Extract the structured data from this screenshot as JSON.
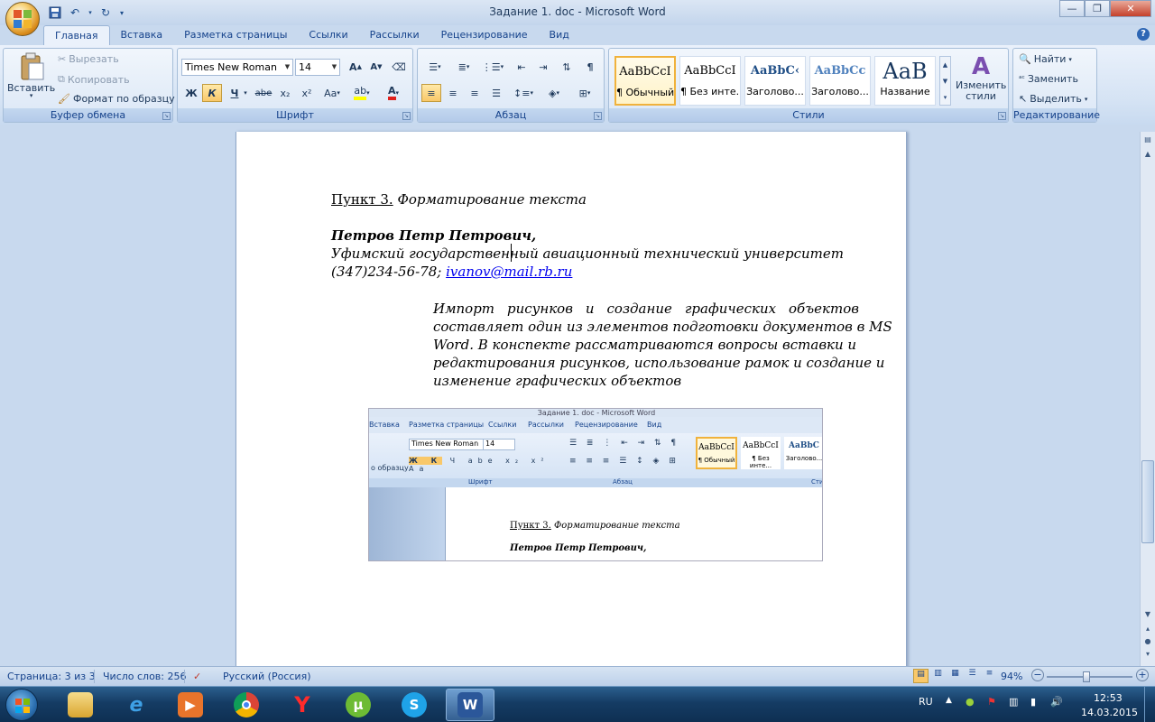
{
  "window": {
    "title": "Задание 1. doc - Microsoft Word"
  },
  "qat": {
    "save_icon": "save-icon",
    "undo_icon": "undo-icon",
    "redo_icon": "redo-icon"
  },
  "tabs": [
    "Главная",
    "Вставка",
    "Разметка страницы",
    "Ссылки",
    "Рассылки",
    "Рецензирование",
    "Вид"
  ],
  "ribbon": {
    "clipboard": {
      "label": "Буфер обмена",
      "paste": "Вставить",
      "cut": "Вырезать",
      "copy": "Копировать",
      "format_painter": "Формат по образцу"
    },
    "font": {
      "label": "Шрифт",
      "font_name": "Times New Roman",
      "font_size": "14",
      "bold": "Ж",
      "italic": "К",
      "underline": "Ч",
      "strike": "abe",
      "subscript": "x₂",
      "superscript": "x²",
      "change_case": "Aa"
    },
    "paragraph": {
      "label": "Абзац"
    },
    "styles": {
      "label": "Стили",
      "items": [
        {
          "sample": "AaBbCcI",
          "name": "¶ Обычный"
        },
        {
          "sample": "AaBbCcI",
          "name": "¶ Без инте..."
        },
        {
          "sample": "AaBbC‹",
          "name": "Заголово..."
        },
        {
          "sample": "AaBbCc",
          "name": "Заголово..."
        },
        {
          "sample": "AaB",
          "name": "Название"
        }
      ],
      "change_styles": "Изменить стили"
    },
    "editing": {
      "label": "Редактирование",
      "find": "Найти",
      "replace": "Заменить",
      "select": "Выделить"
    }
  },
  "document": {
    "heading_label": "Пункт 3.",
    "heading_text": "Форматирование текста",
    "author": "Петров Петр Петрович,",
    "university": "Уфимский государственный авиационный технический университет",
    "phone": "(347)234-56-78; ",
    "email": "ivanov@mail.rb.ru",
    "abstract": [
      "Импорт рисунков и создание графических объектов",
      "составляет один из элементов подготовки документов в MS",
      "Word. В конспекте рассматриваются вопросы вставки и",
      "редактирования рисунков, использование рамок и создание и",
      "изменение графических объектов"
    ],
    "embedded": {
      "title": "Задание 1. doc - Microsoft Word",
      "tabs": [
        "Вставка",
        "Разметка страницы",
        "Ссылки",
        "Рассылки",
        "Рецензирование",
        "Вид"
      ],
      "font_name": "Times New Roman",
      "font_size": "14",
      "left_label": "о образцу",
      "group_font": "Шрифт",
      "group_par": "Абзац",
      "group_styles": "Сти",
      "styles": [
        {
          "sample": "AaBbCcI",
          "name": "¶ Обычный"
        },
        {
          "sample": "AaBbCcI",
          "name": "¶ Без инте..."
        },
        {
          "sample": "AaBbC",
          "name": "Заголово..."
        }
      ],
      "heading_label": "Пункт 3.",
      "heading_text": "Форматирование текста",
      "author": "Петров Петр Петрович,"
    }
  },
  "status": {
    "page": "Страница: 3 из 3",
    "words": "Число слов: 256",
    "language": "Русский (Россия)",
    "zoom": "94%"
  },
  "taskbar": {
    "lang": "RU",
    "time": "12:53",
    "date": "14.03.2015"
  }
}
